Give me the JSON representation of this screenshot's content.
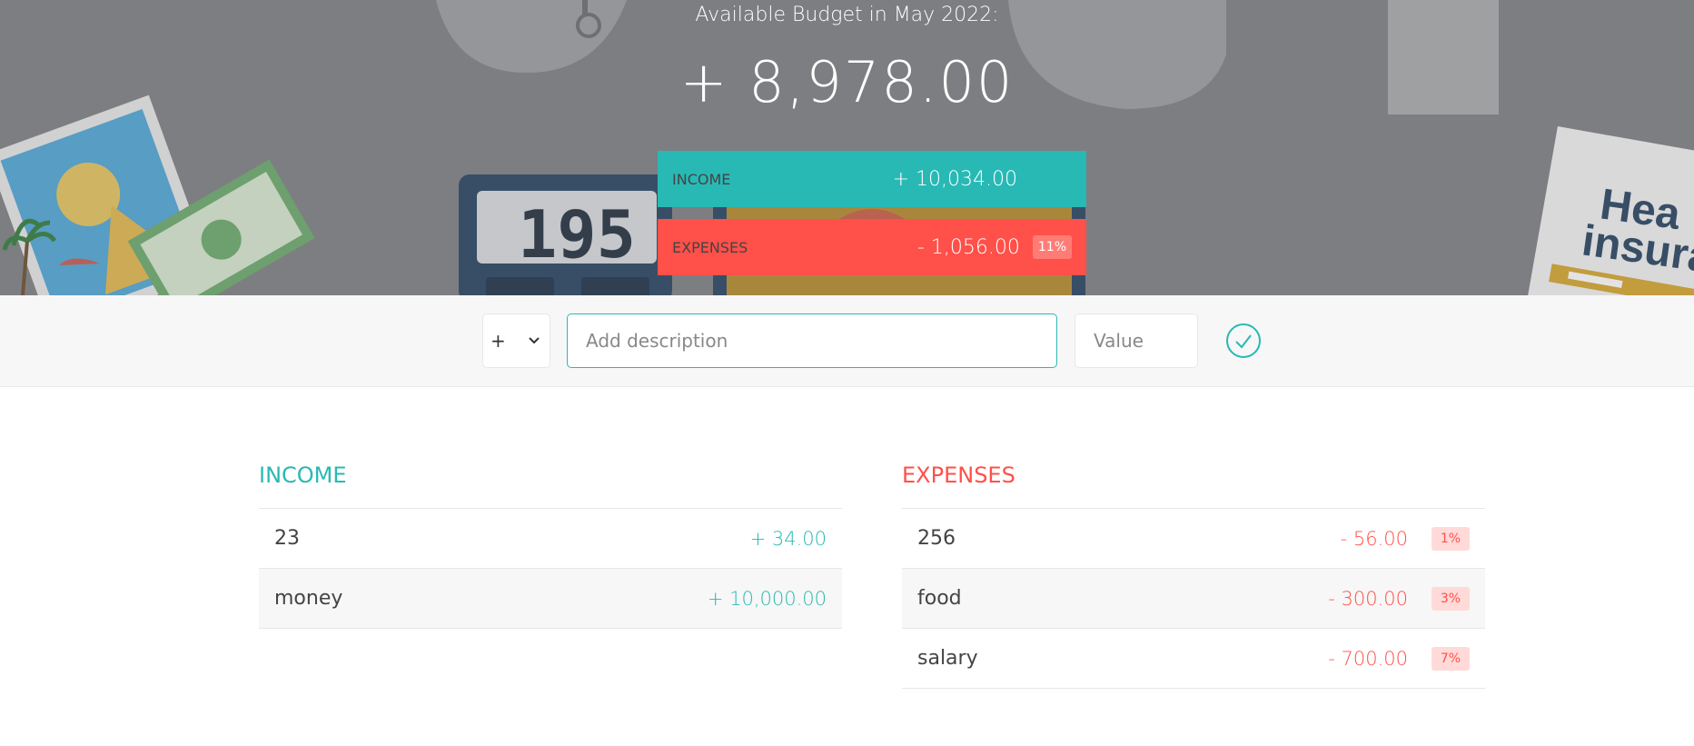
{
  "header": {
    "title": "Available Budget in May 2022:",
    "budget": "+ 8,978.00",
    "income_label": "INCOME",
    "income_value": "+ 10,034.00",
    "expenses_label": "EXPENSES",
    "expenses_value": "- 1,056.00",
    "expenses_percentage": "11%",
    "background_art_text": [
      "195",
      "Hea",
      "insura"
    ]
  },
  "add_bar": {
    "type_selected": "+",
    "description_placeholder": "Add description",
    "value_placeholder": "Value"
  },
  "income": {
    "title": "INCOME",
    "items": [
      {
        "description": "23",
        "value": "+ 34.00"
      },
      {
        "description": "money",
        "value": "+ 10,000.00"
      }
    ]
  },
  "expenses": {
    "title": "EXPENSES",
    "items": [
      {
        "description": "256",
        "value": "- 56.00",
        "percentage": "1%"
      },
      {
        "description": "food",
        "value": "- 300.00",
        "percentage": "3%"
      },
      {
        "description": "salary",
        "value": "- 700.00",
        "percentage": "7%"
      }
    ]
  },
  "colors": {
    "income": "#28b9b5",
    "expenses": "#ff5049",
    "hero_background": "#7d7e80"
  },
  "icons": {
    "submit": "check-circle-icon",
    "type_dropdown": "chevron-down-icon"
  }
}
